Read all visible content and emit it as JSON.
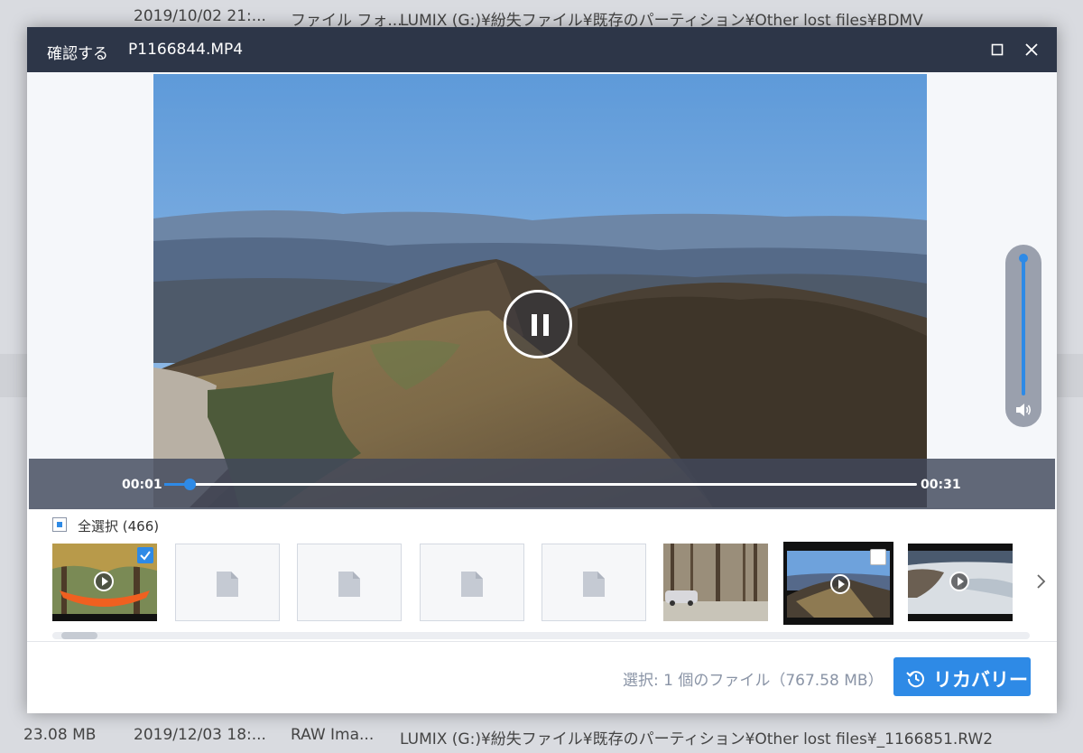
{
  "background": {
    "top_row": {
      "date": "2019/10/02 21:...",
      "type": "ファイル フォ...",
      "path": "LUMIX (G:)¥紛失ファイル¥既存のパーティション¥Other lost files¥BDMV"
    },
    "bottom_row": {
      "size": "23.08 MB",
      "date": "2019/12/03 18:...",
      "type": "RAW Ima...",
      "path": "LUMIX (G:)¥紛失ファイル¥既存のパーティション¥Other lost files¥_1166851.RW2"
    }
  },
  "dialog": {
    "title_label": "確認する",
    "file_name": "P1166844.MP4"
  },
  "player": {
    "current_time": "00:01",
    "total_time": "00:31",
    "progress_fraction": 0.034,
    "volume_fraction": 1.0,
    "state": "playing"
  },
  "select_all": {
    "label": "全選択 (466)",
    "state": "partial"
  },
  "thumbnails": [
    {
      "kind": "video",
      "scene": "hammock",
      "checked": true
    },
    {
      "kind": "blank"
    },
    {
      "kind": "blank"
    },
    {
      "kind": "blank"
    },
    {
      "kind": "blank"
    },
    {
      "kind": "image",
      "scene": "forest-car"
    },
    {
      "kind": "video",
      "scene": "mountain",
      "checked": false,
      "focused": true
    },
    {
      "kind": "video",
      "scene": "snow"
    }
  ],
  "footer": {
    "status": "選択: 1 個のファイル（767.58 MB）",
    "recover_label": "リカバリー"
  },
  "colors": {
    "titlebar": "#2d3648",
    "accent": "#2e8ae6"
  }
}
